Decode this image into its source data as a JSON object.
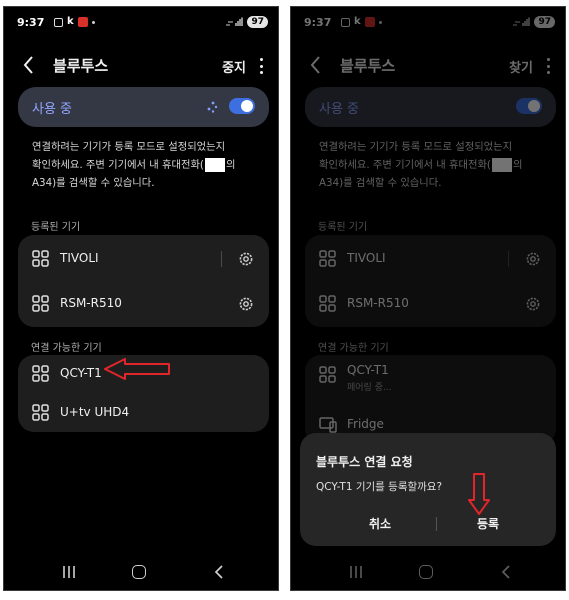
{
  "status": {
    "time": "9:37",
    "battery": "97",
    "k_label": "k"
  },
  "left": {
    "title": "블루투스",
    "header_action": "중지",
    "use_label": "사용 중",
    "desc_line1": "연결하려는 기기가 등록 모드로 설정되었는지",
    "desc_line2_a": "확인하세요. 주변 기기에서 내 휴대전화(",
    "desc_line2_b": "의",
    "desc_line3": "A34)를 검색할 수 있습니다.",
    "registered_label": "등록된 기기",
    "registered": [
      "TIVOLI",
      "RSM-R510"
    ],
    "available_label": "연결 가능한 기기",
    "available": [
      "QCY-T1",
      "U+tv UHD4"
    ]
  },
  "right": {
    "title": "블루투스",
    "header_action": "찾기",
    "use_label": "사용 중",
    "registered_label": "등록된 기기",
    "registered": [
      "TIVOLI",
      "RSM-R510"
    ],
    "available_label": "연결 가능한 기기",
    "available": [
      {
        "name": "QCY-T1",
        "sub": "페어링 중..."
      },
      {
        "name": "Fridge"
      }
    ],
    "dialog": {
      "title": "블루투스 연결 요청",
      "message": "QCY-T1 기기를 등록할까요?",
      "cancel": "취소",
      "ok": "등록"
    }
  },
  "colors": {
    "accent": "#3e6fe0",
    "use_text": "#93a5ff",
    "annotation_arrow": "#e0262b"
  },
  "icons": [
    "back-icon",
    "kebab-menu-icon",
    "sparkle-icon",
    "device-icon",
    "gear-icon",
    "tv-icon",
    "recents-nav-icon",
    "home-nav-icon",
    "back-nav-icon"
  ]
}
